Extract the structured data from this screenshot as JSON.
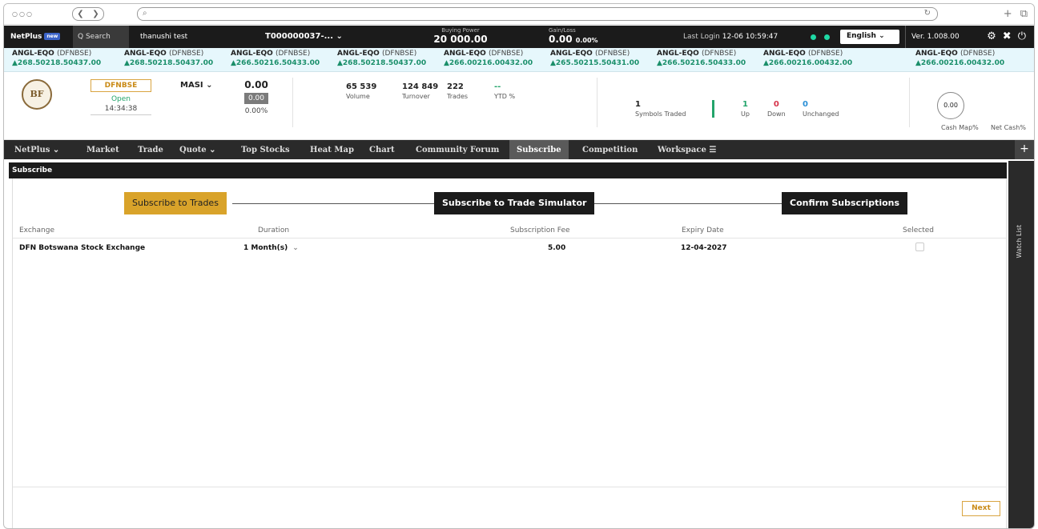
{
  "browser": {
    "controls_dots": "○○○",
    "back_glyph": "❮",
    "forward_glyph": "❯",
    "search_glyph": "⌕",
    "reload_glyph": "↻",
    "new_tab_glyph": "+",
    "window_glyph": "⧉"
  },
  "header": {
    "logo": "NetPlus",
    "logo_badge": "new",
    "search_label": "Q Search",
    "user": "thanushi test",
    "account": "T000000037-... ⌄",
    "buying_power_label": "Buying Power",
    "buying_power_value": "20 000.00",
    "gain_loss_label": "Gain/Loss",
    "gain_loss_value": "0.00",
    "gain_loss_pct": "0.00%",
    "last_login_label": "Last Login",
    "last_login_value": "12-06 10:59:47",
    "language": "English ⌄",
    "version": "Ver. 1.008.00",
    "icons": [
      "gear-icon",
      "expand-icon",
      "power-icon"
    ]
  },
  "ticker": [
    {
      "sym": "ANGL-EQO",
      "ex": "(DFNBSE)",
      "val": "▲268.50218.50437.00"
    },
    {
      "sym": "ANGL-EQO",
      "ex": "(DFNBSE)",
      "val": "▲268.50218.50437.00"
    },
    {
      "sym": "ANGL-EQO",
      "ex": "(DFNBSE)",
      "val": "▲266.50216.50433.00"
    },
    {
      "sym": "ANGL-EQO",
      "ex": "(DFNBSE)",
      "val": "▲268.50218.50437.00"
    },
    {
      "sym": "ANGL-EQO",
      "ex": "(DFNBSE)",
      "val": "▲266.00216.00432.00"
    },
    {
      "sym": "ANGL-EQO",
      "ex": "(DFNBSE)",
      "val": "▲265.50215.50431.00"
    },
    {
      "sym": "ANGL-EQO",
      "ex": "(DFNBSE)",
      "val": "▲266.50216.50433.00"
    },
    {
      "sym": "ANGL-EQO",
      "ex": "(DFNBSE)",
      "val": "▲266.00216.00432.00"
    },
    {
      "sym": "ANGL-EQO",
      "ex": "(DFNBSE)",
      "val": "▲266.00216.00432.00"
    }
  ],
  "summary": {
    "exchange": "DFNBSE",
    "status": "Open",
    "time": "14:34:38",
    "index_name": "MASI ⌄",
    "index_value": "0.00",
    "index_change": "0.00",
    "index_pct": "0.00%",
    "volume_value": "65 539",
    "volume_label": "Volume",
    "turnover_value": "124 849",
    "turnover_label": "Turnover",
    "trades_value": "222",
    "trades_label": "Trades",
    "ytd_value": "--",
    "ytd_label": "YTD %",
    "symbols_traded_value": "1",
    "symbols_traded_label": "Symbols Traded",
    "up_value": "1",
    "up_label": "Up",
    "down_value": "0",
    "down_label": "Down",
    "unchanged_value": "0",
    "unchanged_label": "Unchanged",
    "gauge_value": "0.00",
    "cash_map_label": "Cash Map%",
    "net_cash_label": "Net Cash%",
    "colors": {
      "up": "#23a46b",
      "down": "#d6334a",
      "unchanged": "#2a8fd6"
    }
  },
  "nav": {
    "items": [
      "NetPlus ⌄",
      "Market",
      "Trade",
      "Quote ⌄",
      "Top Stocks",
      "Heat Map",
      "Chart",
      "Community Forum",
      "Subscribe",
      "Competition",
      "Workspace ☰"
    ],
    "active": "Subscribe",
    "plus": "+"
  },
  "watch_list_label": "Watch List",
  "subscribe": {
    "title": "Subscribe",
    "steps": [
      "Subscribe to Trades",
      "Subscribe to Trade Simulator",
      "Confirm Subscriptions"
    ],
    "columns": [
      "Exchange",
      "Duration",
      "Subscription Fee",
      "Expiry Date",
      "Selected"
    ],
    "row": {
      "exchange": "DFN Botswana Stock Exchange",
      "duration": "1 Month(s)",
      "duration_drop": "⌄",
      "fee": "5.00",
      "expiry": "12-04-2027",
      "selected": false
    },
    "next_label": "Next"
  }
}
